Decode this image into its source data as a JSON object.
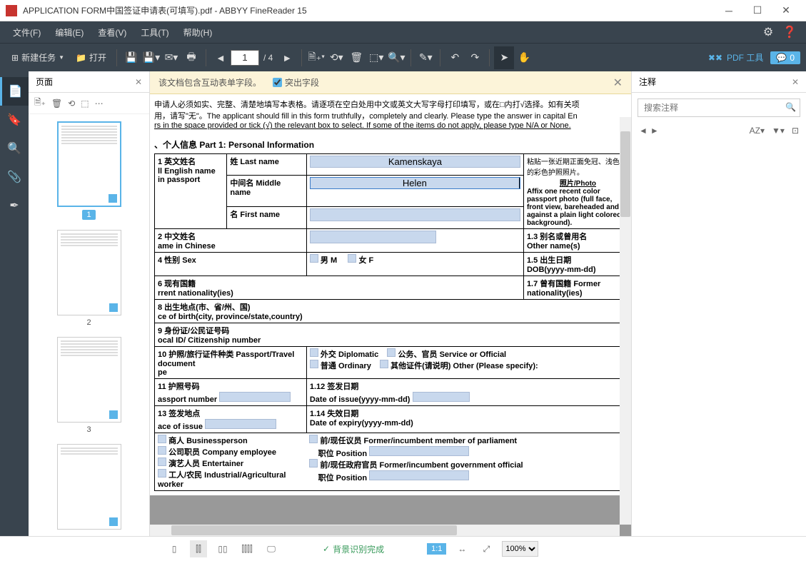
{
  "titlebar": {
    "title": "APPLICATION FORM中国签证申请表(可填写).pdf - ABBYY FineReader 15"
  },
  "menu": {
    "file": "文件(F)",
    "edit": "编辑(E)",
    "view": "查看(V)",
    "tools": "工具(T)",
    "help": "帮助(H)"
  },
  "toolbar": {
    "new_task": "新建任务",
    "open": "打开",
    "page_current": "1",
    "page_total": "/ 4",
    "pdf_tools": "PDF 工具",
    "comment_count": "0"
  },
  "pages_panel": {
    "title": "页面",
    "thumbs": [
      "1",
      "2",
      "3"
    ]
  },
  "info_bar": {
    "text": "该文档包含互动表单字段。",
    "highlight_label": "突出字段"
  },
  "comments_panel": {
    "title": "注释",
    "search_placeholder": "搜索注释",
    "sort": "AZ"
  },
  "bottom_bar": {
    "bg_status": "背景识别完成",
    "fit": "1:1",
    "zoom": "100%"
  },
  "doc": {
    "instr1": "申请人必须如实、完整、清楚地填写本表格。请逐项在空白处用中文或英文大写字母打印填写，或在□内打√选择。如有关项",
    "instr2": "用，请写\"无\"。The  applicant should fill in this form truthfully，completely and clearly. Please type the answer in capital En",
    "instr3": "rs in the space provided or tick (√) the relevant box to select. If some of the items do not apply, please type N/A or None.",
    "part1": "、个人信息  Part 1: Personal Information",
    "f1_1_label": "1 英文姓名",
    "f1_1_sub": "ll English name in passport",
    "last_name_label": "姓 Last name",
    "last_name_value": "Kamenskaya",
    "middle_name_label": "中间名 Middle name",
    "middle_name_value": "Helen",
    "first_name_label": "名 First name",
    "photo_title": "照片/Photo",
    "photo_cn": "粘贴一张近期正面免冠、浅色景的彩色护照照片。",
    "photo_en": "Affix one recent color passport photo (full face, front view, bareheaded and against a plain light colored background).",
    "f1_2": "2 中文姓名",
    "f1_2_en": "ame in Chinese",
    "f1_3": "1.3 别名或曾用名",
    "f1_3_en": "Other name(s)",
    "f1_4": "4 性别  Sex",
    "sex_m": "男  M",
    "sex_f": "女  F",
    "f1_5": "1.5 出生日期",
    "f1_5_en": "DOB(yyyy-mm-dd)",
    "f1_6": "6 现有国籍",
    "f1_6_en": "rrent nationality(ies)",
    "f1_7": "1.7 曾有国籍 Former nationality(ies)",
    "f1_8": "8 出生地点(市、省/州、国)",
    "f1_8_en": "ce of birth(city, province/state,country)",
    "f1_9": "9 身份证/公民证号码",
    "f1_9_en": "ocal ID/ Citizenship number",
    "f1_10": "10 护照/旅行证件种类 Passport/Travel document",
    "f1_10_en": "pe",
    "pt_diplomatic": "外交 Diplomatic",
    "pt_ordinary": "普通 Ordinary",
    "pt_service": "公务、官员 Service or Official",
    "pt_other": "其他证件(请说明) Other (Please specify):",
    "f1_11": "11 护照号码",
    "f1_11_en": "assport number",
    "f1_12": "1.12 签发日期",
    "f1_12_en": "Date of issue(yyyy-mm-dd)",
    "f1_13": "13 签发地点",
    "f1_13_en": "ace of issue",
    "f1_14": "1.14 失效日期",
    "f1_14_en": "Date of expiry(yyyy-mm-dd)",
    "occ_business": "商人 Businessperson",
    "occ_employee": "公司职员 Company employee",
    "occ_entertainer": "演艺人员 Entertainer",
    "occ_worker": "工人/农民 Industrial/Agricultural worker",
    "occ_parliament": "前/现任议员 Former/incumbent member of parliament",
    "occ_position": "职位 Position",
    "occ_gov": "前/现任政府官员 Former/incumbent government official",
    "occ_position2": "职位 Position"
  }
}
